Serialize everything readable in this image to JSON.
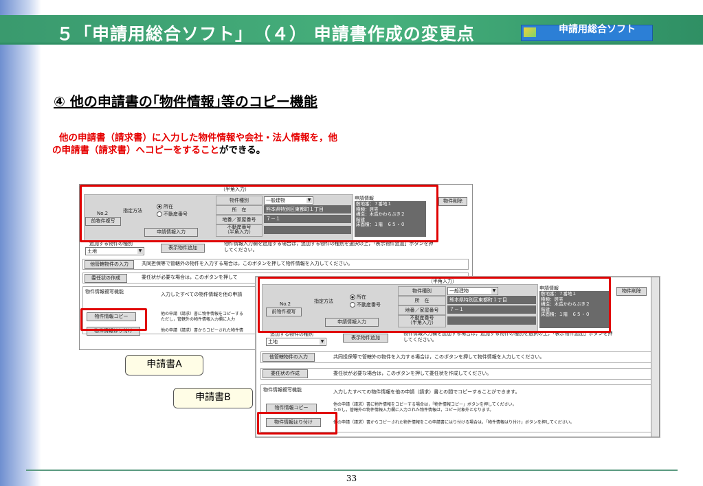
{
  "header": {
    "title": "５「申請用総合ソフト」　（４） 申請書作成の変更点",
    "logo_text": "申請用総合ソフト"
  },
  "section": {
    "heading": "④ 他の申請書の｢物件情報｣等のコピー機能"
  },
  "description": {
    "red_line1": "他の申請書（請求書）に入力した物件情報や会社・法人情報を，他",
    "red_line2": "の申請書（請求書）へコピーをすること",
    "tail": "ができる。"
  },
  "form": {
    "half_width_label": "（半角入力）",
    "property_type_label": "物件種別",
    "property_type_value": "一般建物",
    "location_label": "所　在",
    "location_value": "熊本県特別区東都町１丁目",
    "lot_label": "地番／家屋番号",
    "lot_value": "７－１",
    "realty_no_label": "不動産番号",
    "realty_no_sub": "（半角入力）",
    "method_label": "指定方法",
    "radio_location": "所在",
    "radio_realty": "不動産番号",
    "no_label": "No.2",
    "prev_button": "前物件複写",
    "apply_info_button": "申請情報入力",
    "apply_info_title": "申請情報",
    "apply_info_lines": [
      "敷地番：７番地１",
      "種類：居宅",
      "構造：木造かわらぶき２",
      "階建",
      "床面積：１階　６５・０"
    ],
    "apply_info_lines_b": [
      "敷地番：７番地１",
      "種類：居宅",
      "構造：木造かわらぶき２",
      "階建",
      "床面積：１階　６５・０"
    ],
    "delete_button": "物件削除",
    "add_kind_label": "追加する物件の種別",
    "add_kind_value": "土地",
    "show_add_button": "表示物件追加",
    "add_help_a": "物件情報入力欄を追加する場合は，追加する物件の種別を選択の上，「表示物件追加」ボタンを押",
    "add_help_a2": "してください。",
    "add_help_b": "物件情報入力欄を追加する場合は，追加する物件の種別を選択の上，「表示物件追加」ボタンを押",
    "add_help_b2": "してください。",
    "other_button": "他管轄物件の入力",
    "other_help": "共同担保等で管轄外の物件を入力する場合は，このボタンを押して物件情報を入力してください。",
    "mandate_button": "委任状の作成",
    "mandate_help_a": "委任状が必要な場合は，このボタンを押して",
    "mandate_help_b": "委任状が必要な場合は，このボタンを押して委任状を作成してください。",
    "copy_section_label": "物件情報複写機能",
    "copy_help_a": "入力したすべての物件情報を他の申請",
    "copy_help_b": "入力したすべての物件情報を他の申請（請求）書との間でコピーすることができます。",
    "copy_button": "物件情報コピー",
    "copy_sub_a1": "他の申請（請求）書に物件情報をコピーする",
    "copy_sub_a2": "ただし，管轄外の物件情報入力欄に入力",
    "copy_sub_b1": "他の申請（請求）書に物件情報をコピーする場合は，「物件情報コピー」ボタンを押してください。",
    "copy_sub_b2": "ただし，管轄外の物件情報入力欄に入力された物件情報は，コピー対象外となります。",
    "paste_button": "物件情報はり付け",
    "paste_help_a": "他の申請（請求）書からコピーされた物件情",
    "paste_help_b": "他の申請（請求）書からコピーされた物件情報をこの申請書にはり付ける場合は，「物件情報はり付け」ボタンを押してください。"
  },
  "labels": {
    "app_a": "申請書A",
    "app_b": "申請書B"
  },
  "footer": {
    "page_number": "33"
  },
  "colors": {
    "header_green": "#46b07c",
    "highlight_red": "#e00000"
  }
}
